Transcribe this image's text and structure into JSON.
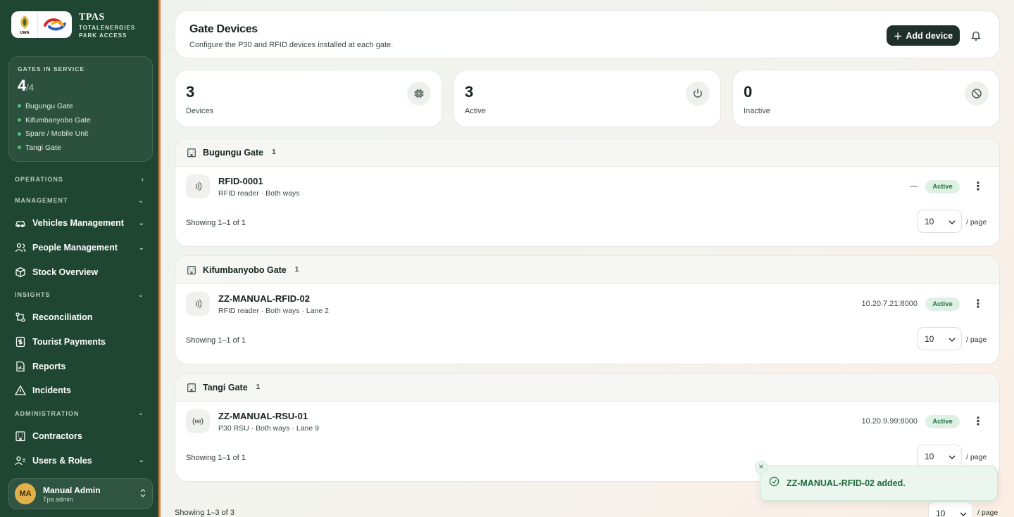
{
  "brand": {
    "title": "TPAS",
    "subtitle_line1": "TOTALENERGIES",
    "subtitle_line2": "PARK ACCESS",
    "uwa_text": "UWA"
  },
  "gates_card": {
    "caption": "GATES IN SERVICE",
    "count": "4",
    "total": "/4",
    "gates": [
      "Bugungu Gate",
      "Kifumbanyobo Gate",
      "Spare / Mobile Unit",
      "Tangi Gate"
    ]
  },
  "nav": {
    "operations": "OPERATIONS",
    "management": "MANAGEMENT",
    "vehicles": "Vehicles Management",
    "people": "People Management",
    "stock": "Stock Overview",
    "insights": "INSIGHTS",
    "reconciliation": "Reconciliation",
    "tourist_payments": "Tourist Payments",
    "reports": "Reports",
    "incidents": "Incidents",
    "administration": "ADMINISTRATION",
    "contractors": "Contractors",
    "users_roles": "Users & Roles"
  },
  "user": {
    "initials": "MA",
    "name": "Manual Admin",
    "role": "Tpa admin"
  },
  "header": {
    "title": "Gate Devices",
    "subtitle": "Configure the P30 and RFID devices installed at each gate.",
    "add_label": "Add device"
  },
  "stats": {
    "devices": {
      "value": "3",
      "label": "Devices"
    },
    "active": {
      "value": "3",
      "label": "Active"
    },
    "inactive": {
      "value": "0",
      "label": "Inactive"
    }
  },
  "groups": [
    {
      "name": "Bugungu Gate",
      "count": "1",
      "device": {
        "name": "RFID-0001",
        "meta": "RFID reader · Both ways",
        "address": "—",
        "status": "Active"
      },
      "showing": "Showing 1–1 of 1",
      "page_size": "10",
      "per_page": "/ page"
    },
    {
      "name": "Kifumbanyobo Gate",
      "count": "1",
      "device": {
        "name": "ZZ-MANUAL-RFID-02",
        "meta": "RFID reader · Both ways · Lane 2",
        "address": "10.20.7.21:8000",
        "status": "Active"
      },
      "showing": "Showing 1–1 of 1",
      "page_size": "10",
      "per_page": "/ page"
    },
    {
      "name": "Tangi Gate",
      "count": "1",
      "device": {
        "name": "ZZ-MANUAL-RSU-01",
        "meta": "P30 RSU · Both ways · Lane 9",
        "address": "10.20.9.99:8000",
        "status": "Active"
      },
      "showing": "Showing 1–1 of 1",
      "page_size": "10",
      "per_page": "/ page"
    }
  ],
  "footer": {
    "showing": "Showing 1–3 of 3",
    "page_size": "10",
    "per_page": "/ page"
  },
  "toast": {
    "message": "ZZ-MANUAL-RFID-02 added."
  },
  "colors": {
    "sidebar": "#1f4632",
    "accent_dark": "#1f2f29",
    "active_badge_bg": "#dff0e4",
    "active_badge_text": "#23753f",
    "toast_bg": "#eaf6ee"
  },
  "icons": {
    "nav": [
      "car-icon",
      "people-icon",
      "cube-icon",
      "arrows-exchange-icon",
      "receipt-icon",
      "report-icon",
      "warning-icon",
      "building-icon",
      "users-icon"
    ],
    "stats": [
      "chip-icon",
      "power-icon",
      "ban-icon"
    ],
    "devices": [
      "rfid-icon",
      "rfid-icon",
      "broadcast-icon"
    ]
  }
}
